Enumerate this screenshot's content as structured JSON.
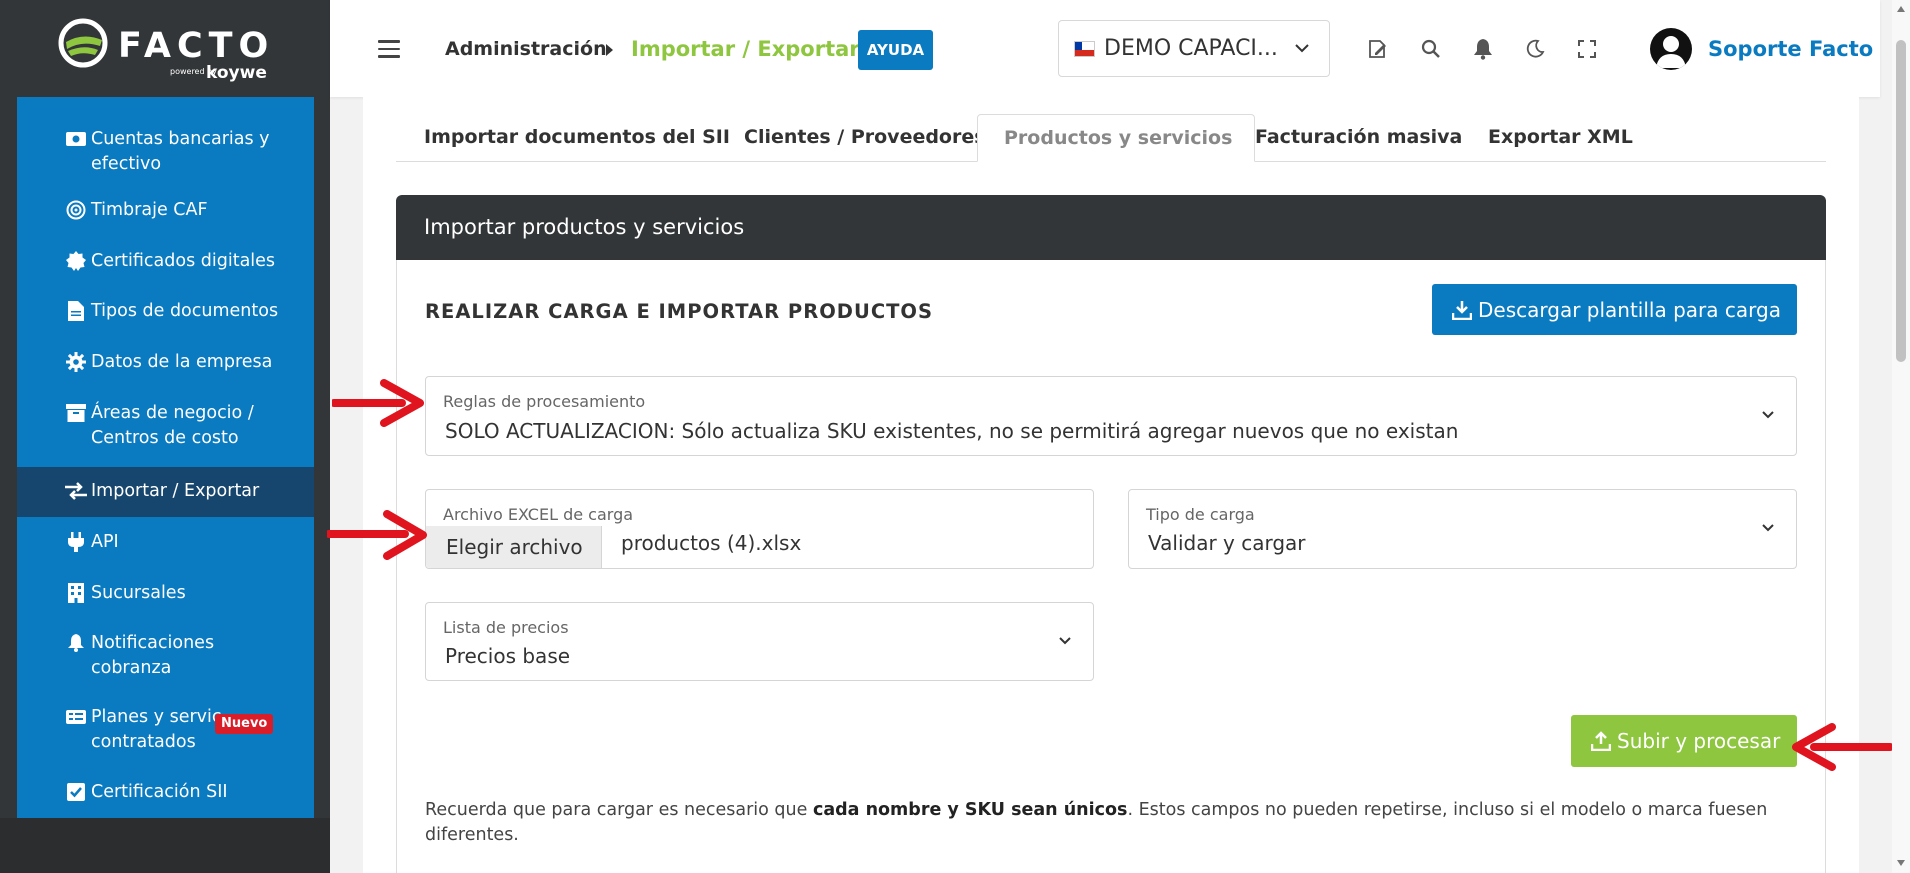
{
  "brand": {
    "logo_text": "FACTO",
    "powered_by": "powered by",
    "partner": "koywe"
  },
  "sidebar": {
    "items": [
      {
        "label": "Cuentas bancarias y\nefectivo",
        "icon": "money-icon"
      },
      {
        "label": "Timbraje CAF",
        "icon": "target-icon"
      },
      {
        "label": "Certificados digitales",
        "icon": "certificate-icon"
      },
      {
        "label": "Tipos de documentos",
        "icon": "document-icon"
      },
      {
        "label": "Datos de la empresa",
        "icon": "gear-icon"
      },
      {
        "label": "Áreas de negocio /\nCentros de costo",
        "icon": "archive-icon"
      },
      {
        "label": "Importar / Exportar",
        "icon": "exchange-icon",
        "active": true
      },
      {
        "label": "API",
        "icon": "plug-icon"
      },
      {
        "label": "Sucursales",
        "icon": "building-icon"
      },
      {
        "label": "Notificaciones\ncobranza",
        "icon": "bell-icon"
      },
      {
        "label": "Planes y servic\ncontratados",
        "icon": "card-icon",
        "badge": "Nuevo"
      },
      {
        "label": "Certificación SII",
        "icon": "check-square-icon"
      }
    ]
  },
  "topbar": {
    "breadcrumb_parent": "Administración",
    "breadcrumb_current": "Importar / Exportar",
    "help_label": "AYUDA",
    "company": "DEMO CAPACI...",
    "user_name": "Soporte Facto"
  },
  "tabs": [
    {
      "label": "Importar documentos del SII"
    },
    {
      "label": "Clientes / Proveedores"
    },
    {
      "label": "Productos y servicios",
      "active": true
    },
    {
      "label": "Facturación masiva"
    },
    {
      "label": "Exportar XML"
    }
  ],
  "panel": {
    "title": "Importar productos y servicios",
    "section_title": "REALIZAR CARGA E IMPORTAR PRODUCTOS",
    "download_label": "Descargar plantilla para carga",
    "rules": {
      "label": "Reglas de procesamiento",
      "value": "SOLO ACTUALIZACION: Sólo actualiza SKU existentes, no se permitirá agregar nuevos que no existan"
    },
    "file": {
      "label": "Archivo EXCEL de carga",
      "button": "Elegir archivo",
      "filename": "productos (4).xlsx"
    },
    "load_type": {
      "label": "Tipo de carga",
      "value": "Validar y cargar"
    },
    "price_list": {
      "label": "Lista de precios",
      "value": "Precios base"
    },
    "upload_label": "Subir y procesar",
    "note_part1": "Recuerda que para cargar es necesario que ",
    "note_bold": "cada nombre y SKU sean únicos",
    "note_part2": ". Estos campos no pueden repetirse, incluso si el modelo o marca fuesen diferentes."
  },
  "colors": {
    "sidebar_bg": "#333638",
    "nav_blue": "#0a7ac1",
    "nav_active": "#16466e",
    "accent_green": "#8ec63f",
    "annotation_red": "#e0141e"
  }
}
